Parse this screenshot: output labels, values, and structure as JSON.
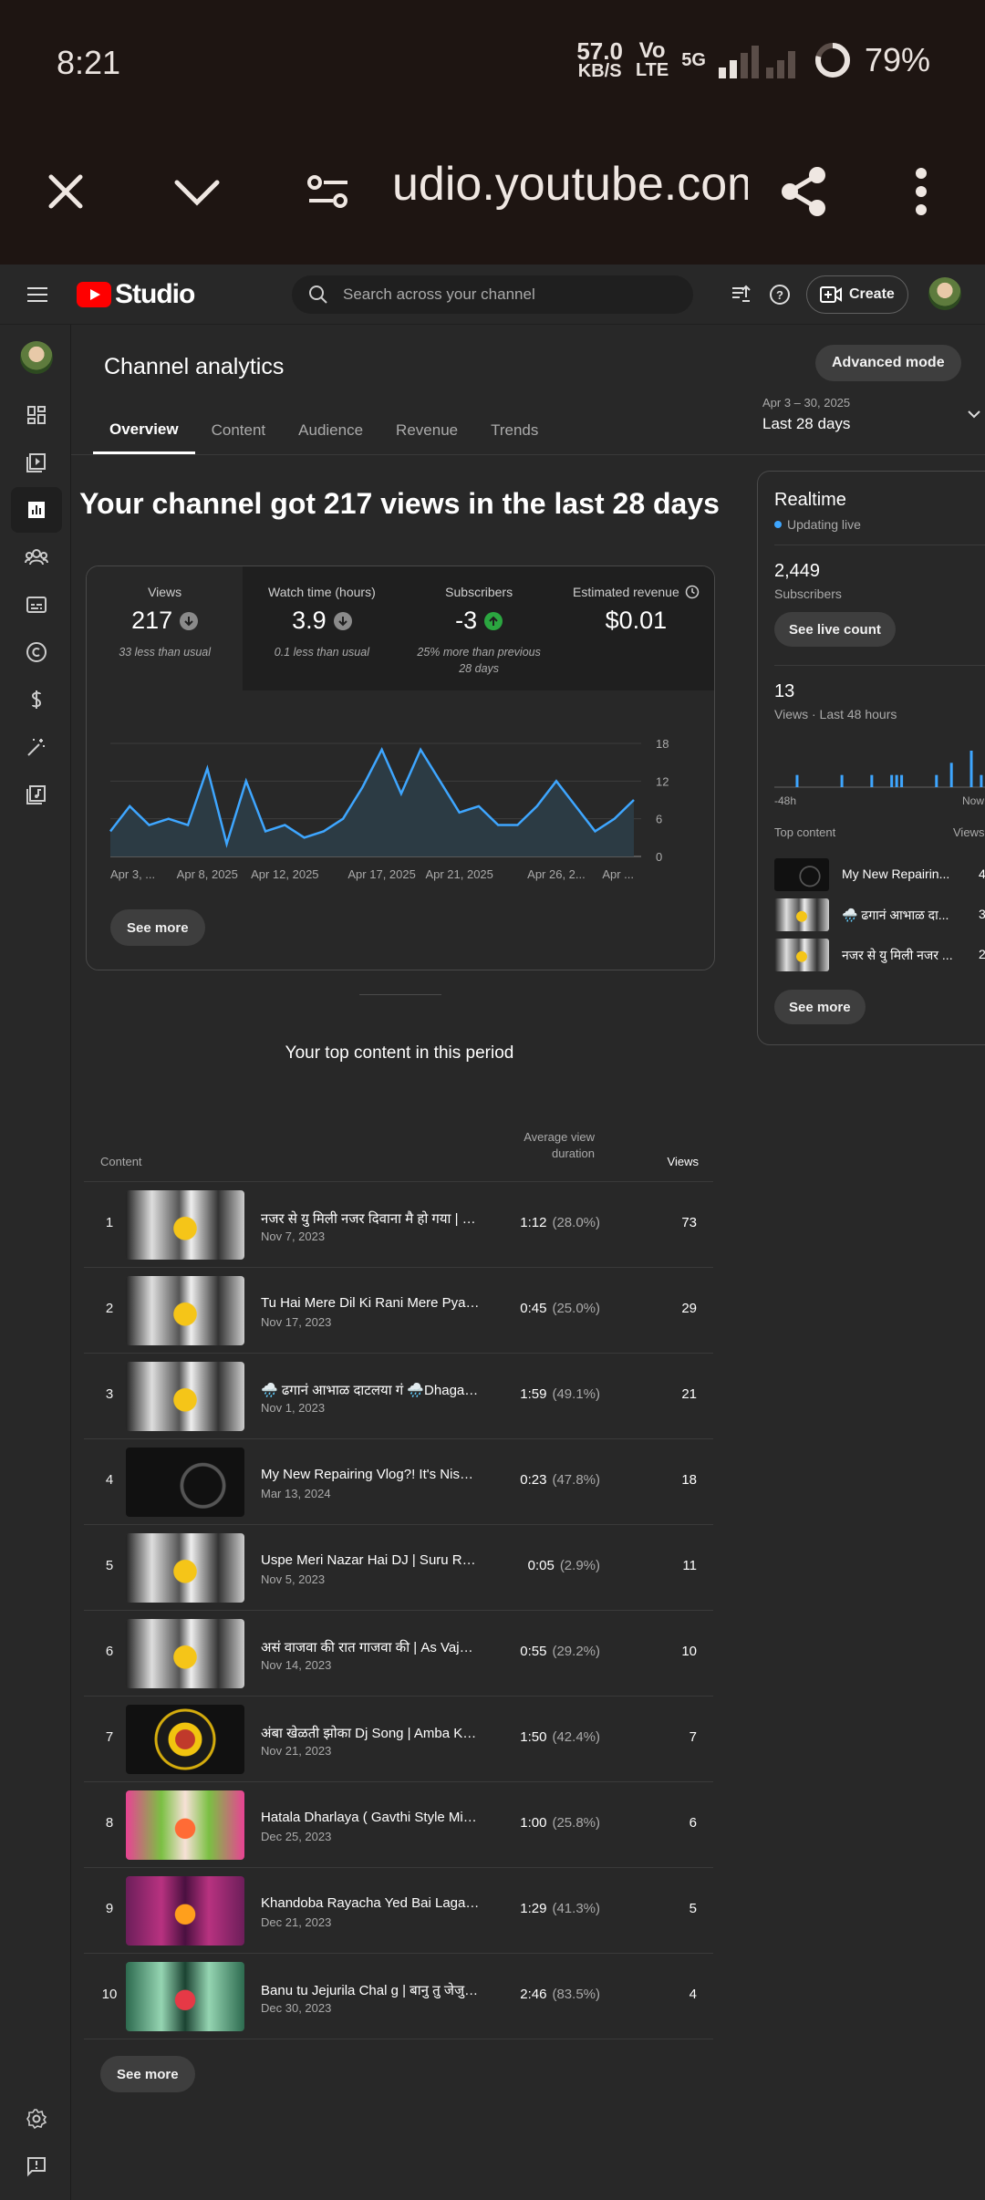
{
  "status_bar": {
    "time": "8:21",
    "net_speed": "57.0",
    "net_unit": "KB/S",
    "vo": "Vo",
    "lte": "LTE",
    "net_type": "5G",
    "battery": "79%"
  },
  "browser": {
    "url": "udio.youtube.com"
  },
  "header": {
    "logo_text": "Studio",
    "search_placeholder": "Search across your channel",
    "create_label": "Create"
  },
  "page": {
    "title": "Channel analytics",
    "advanced_mode_label": "Advanced mode",
    "tabs": [
      {
        "label": "Overview",
        "active": true
      },
      {
        "label": "Content",
        "active": false
      },
      {
        "label": "Audience",
        "active": false
      },
      {
        "label": "Revenue",
        "active": false
      },
      {
        "label": "Trends",
        "active": false
      }
    ],
    "date_range": {
      "sub": "Apr 3 – 30, 2025",
      "main": "Last 28 days"
    },
    "headline": "Your channel got 217 views in the last 28 days"
  },
  "metrics": [
    {
      "label": "Views",
      "value": "217",
      "trend": "down",
      "note": "33 less than usual"
    },
    {
      "label": "Watch time (hours)",
      "value": "3.9",
      "trend": "down",
      "note": "0.1 less than usual"
    },
    {
      "label": "Subscribers",
      "value": "-3",
      "trend": "up",
      "note": "25% more than previous 28 days"
    },
    {
      "label": "Estimated revenue",
      "value": "$0.01",
      "trend": "",
      "note": ""
    }
  ],
  "chart_data": {
    "type": "area",
    "x": [
      "Apr 3",
      "Apr 4",
      "Apr 5",
      "Apr 6",
      "Apr 7",
      "Apr 8",
      "Apr 9",
      "Apr 10",
      "Apr 11",
      "Apr 12",
      "Apr 13",
      "Apr 14",
      "Apr 15",
      "Apr 16",
      "Apr 17",
      "Apr 18",
      "Apr 19",
      "Apr 20",
      "Apr 21",
      "Apr 22",
      "Apr 23",
      "Apr 24",
      "Apr 25",
      "Apr 26",
      "Apr 27",
      "Apr 28",
      "Apr 29",
      "Apr 30"
    ],
    "values": [
      4,
      8,
      5,
      6,
      5,
      14,
      2,
      12,
      4,
      5,
      3,
      4,
      6,
      11,
      17,
      10,
      17,
      12,
      7,
      8,
      5,
      5,
      8,
      12,
      8,
      4,
      6,
      9
    ],
    "tick_labels": [
      "Apr 3, ...",
      "Apr 8, 2025",
      "Apr 12, 2025",
      "Apr 17, 2025",
      "Apr 21, 2025",
      "Apr 26, 2...",
      "Apr ..."
    ],
    "y_ticks": [
      0,
      6,
      12,
      18
    ],
    "ylim": [
      0,
      18
    ],
    "grid": true,
    "color": "#3ea6ff",
    "see_more_label": "See more"
  },
  "top_content": {
    "title": "Your top content in this period",
    "col_content": "Content",
    "col_avd_1": "Average view",
    "col_avd_2": "duration",
    "col_views": "Views",
    "rows": [
      {
        "rank": "1",
        "title": "नजर से यु मिली नजर दिवाना मै हो गया | Naj...",
        "date": "Nov 7, 2023",
        "avd": "1:12",
        "pct": "(28.0%)",
        "views": "73",
        "thumb": "bw"
      },
      {
        "rank": "2",
        "title": "Tu Hai Mere Dil Ki Rani Mere Pyar Ki...",
        "date": "Nov 17, 2023",
        "avd": "0:45",
        "pct": "(25.0%)",
        "views": "29",
        "thumb": "bw"
      },
      {
        "rank": "3",
        "title": "🌧️ ढगानं आभाळ दाटलया गं 🌧️Dhagan ...",
        "date": "Nov 1, 2023",
        "avd": "1:59",
        "pct": "(49.1%)",
        "views": "21",
        "thumb": "bw"
      },
      {
        "rank": "4",
        "title": "My New Repairing Vlog?! It's Nisha ...",
        "date": "Mar 13, 2024",
        "avd": "0:23",
        "pct": "(47.8%)",
        "views": "18",
        "thumb": "vlog"
      },
      {
        "rank": "5",
        "title": "Uspe Meri Nazar Hai DJ | Suru Ru R...",
        "date": "Nov 5, 2023",
        "avd": "0:05",
        "pct": "(2.9%)",
        "views": "11",
        "thumb": "bw"
      },
      {
        "rank": "6",
        "title": "असं वाजवा की रात गाजवा की | As Vajva ...",
        "date": "Nov 14, 2023",
        "avd": "0:55",
        "pct": "(29.2%)",
        "views": "10",
        "thumb": "bw"
      },
      {
        "rank": "7",
        "title": "अंबा खेळती झोका Dj Song | Amba Khel...",
        "date": "Nov 21, 2023",
        "avd": "1:50",
        "pct": "(42.4%)",
        "views": "7",
        "thumb": "gold"
      },
      {
        "rank": "8",
        "title": "Hatala Dharlaya ( Gavthi Style Mix ) ...",
        "date": "Dec 25, 2023",
        "avd": "1:00",
        "pct": "(25.8%)",
        "views": "6",
        "thumb": "pink"
      },
      {
        "rank": "9",
        "title": "Khandoba Rayacha Yed Bai Lagal Dj...",
        "date": "Dec 21, 2023",
        "avd": "1:29",
        "pct": "(41.3%)",
        "views": "5",
        "thumb": "purple"
      },
      {
        "rank": "10",
        "title": "Banu tu Jejurila Chal g | बानु तु जेजुरी...",
        "date": "Dec 30, 2023",
        "avd": "2:46",
        "pct": "(83.5%)",
        "views": "4",
        "thumb": "green"
      }
    ],
    "see_more_label": "See more"
  },
  "realtime": {
    "title": "Realtime",
    "live_label": "Updating live",
    "subscribers": "2,449",
    "subscribers_label": "Subscribers",
    "live_count_label": "See live count",
    "views": "13",
    "views_label": "Views · Last 48 hours",
    "axis_left": "-48h",
    "axis_right": "Now",
    "hourly_views": [
      0,
      0,
      0,
      0,
      1,
      0,
      0,
      0,
      0,
      0,
      0,
      0,
      0,
      1,
      0,
      0,
      0,
      0,
      0,
      1,
      0,
      0,
      0,
      1,
      1,
      1,
      0,
      0,
      0,
      0,
      0,
      0,
      1,
      0,
      0,
      2,
      0,
      0,
      0,
      3,
      0,
      1,
      0,
      0,
      0,
      0,
      0,
      1
    ],
    "top_content_label": "Top content",
    "views_col_label": "Views",
    "items": [
      {
        "title": "My New Repairin...",
        "views": "4",
        "thumb": "vlog"
      },
      {
        "title": "🌧️ ढगानं आभाळ दा...",
        "views": "3",
        "thumb": "bw"
      },
      {
        "title": "नजर से यु मिली नजर ...",
        "views": "2",
        "thumb": "bw"
      }
    ],
    "see_more_label": "See more"
  },
  "colors": {
    "accent": "#3ea6ff",
    "brand_red": "#ff0000",
    "up": "#2ba640",
    "background": "#282828"
  }
}
